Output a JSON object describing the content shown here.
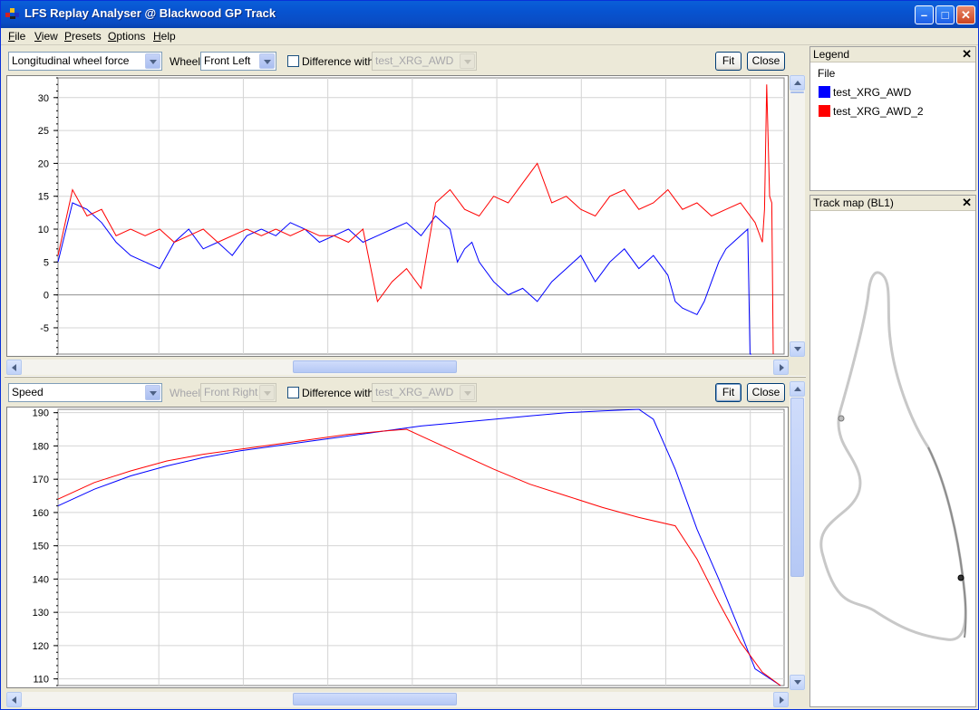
{
  "window": {
    "title": "LFS Replay Analyser @ Blackwood GP Track"
  },
  "menu": [
    {
      "label": "File",
      "key": "F",
      "rest": "ile"
    },
    {
      "label": "View",
      "key": "V",
      "rest": "iew"
    },
    {
      "label": "Presets",
      "key": "P",
      "rest": "resets"
    },
    {
      "label": "Options",
      "key": "O",
      "rest": "ptions"
    },
    {
      "label": "Help",
      "key": "H",
      "rest": "elp"
    }
  ],
  "top_panel": {
    "channel": "Longitudinal wheel force",
    "wheel_label": "Wheel",
    "wheel_value": "Front Left",
    "difference_label": "Difference with",
    "difference_value": "test_XRG_AWD",
    "fit_label": "Fit",
    "close_label": "Close"
  },
  "bottom_panel": {
    "channel": "Speed",
    "wheel_label": "Wheel",
    "wheel_value": "Front Right",
    "difference_label": "Difference with",
    "difference_value": "test_XRG_AWD",
    "fit_label": "Fit",
    "close_label": "Close"
  },
  "legend": {
    "title": "Legend",
    "column": "File",
    "items": [
      {
        "name": "test_XRG_AWD",
        "color": "#0000ff"
      },
      {
        "name": "test_XRG_AWD_2",
        "color": "#ff0000"
      }
    ]
  },
  "track_map": {
    "title": "Track map (BL1)"
  },
  "chart_data": [
    {
      "type": "line",
      "ylim": [
        -9,
        33
      ],
      "yticks": [
        -5,
        0,
        5,
        10,
        15,
        20,
        25,
        30
      ],
      "xlim": [
        0,
        100
      ],
      "series": [
        {
          "name": "test_XRG_AWD",
          "color": "#0000ff",
          "x": [
            0,
            2,
            4,
            6,
            8,
            10,
            12,
            14,
            16,
            18,
            20,
            22,
            24,
            26,
            28,
            30,
            32,
            34,
            36,
            38,
            40,
            42,
            44,
            46,
            48,
            50,
            52,
            54,
            55,
            56,
            57,
            58,
            60,
            62,
            64,
            66,
            68,
            70,
            72,
            74,
            76,
            78,
            80,
            82,
            84,
            85,
            86,
            88,
            89,
            90,
            91,
            92,
            93,
            94,
            95,
            95.3,
            95.4,
            95.5
          ],
          "y": [
            5,
            14,
            13,
            11,
            8,
            6,
            5,
            4,
            8,
            10,
            7,
            8,
            6,
            9,
            10,
            9,
            11,
            10,
            8,
            9,
            10,
            8,
            9,
            10,
            11,
            9,
            12,
            10,
            5,
            7,
            8,
            5,
            2,
            0,
            1,
            -1,
            2,
            4,
            6,
            2,
            5,
            7,
            4,
            6,
            3,
            -1,
            -2,
            -3,
            -1,
            2,
            5,
            7,
            8,
            9,
            10,
            -9,
            -9,
            -9
          ]
        },
        {
          "name": "test_XRG_AWD_2",
          "color": "#ff0000",
          "x": [
            0,
            2,
            4,
            6,
            8,
            10,
            12,
            14,
            16,
            18,
            20,
            22,
            24,
            26,
            28,
            30,
            32,
            34,
            36,
            38,
            40,
            42,
            44,
            46,
            48,
            50,
            52,
            54,
            56,
            58,
            60,
            62,
            64,
            66,
            68,
            70,
            72,
            74,
            76,
            78,
            80,
            82,
            84,
            86,
            88,
            90,
            92,
            94,
            96,
            97,
            97.3,
            97.6,
            98,
            98.3,
            98.5
          ],
          "y": [
            6,
            16,
            12,
            13,
            9,
            10,
            9,
            10,
            8,
            9,
            10,
            8,
            9,
            10,
            9,
            10,
            9,
            10,
            9,
            9,
            8,
            10,
            -1,
            2,
            4,
            1,
            14,
            16,
            13,
            12,
            15,
            14,
            17,
            20,
            14,
            15,
            13,
            12,
            15,
            16,
            13,
            14,
            16,
            13,
            14,
            12,
            13,
            14,
            11,
            8,
            13,
            32,
            15,
            14,
            -9
          ]
        }
      ]
    },
    {
      "type": "line",
      "ylim": [
        108,
        191
      ],
      "yticks": [
        110,
        120,
        130,
        140,
        150,
        160,
        170,
        180,
        190
      ],
      "xlim": [
        0,
        100
      ],
      "series": [
        {
          "name": "test_XRG_AWD",
          "color": "#0000ff",
          "x": [
            0,
            5,
            10,
            15,
            20,
            25,
            30,
            35,
            40,
            45,
            50,
            55,
            60,
            65,
            70,
            75,
            80,
            82,
            85,
            88,
            91,
            94,
            96,
            99.5
          ],
          "y": [
            162,
            167,
            171,
            174,
            176.5,
            178.5,
            180,
            181.5,
            183,
            184.5,
            186,
            187,
            188,
            189,
            190,
            190.5,
            191,
            188,
            173,
            155,
            140,
            124,
            113,
            108
          ]
        },
        {
          "name": "test_XRG_AWD_2",
          "color": "#ff0000",
          "x": [
            0,
            5,
            10,
            15,
            20,
            25,
            30,
            35,
            40,
            45,
            48,
            50,
            55,
            60,
            65,
            70,
            75,
            80,
            85,
            88,
            91,
            94,
            97,
            99.5
          ],
          "y": [
            164,
            169,
            172.5,
            175.5,
            177.5,
            179,
            180.5,
            182,
            183.5,
            184.5,
            185,
            183,
            178,
            173,
            168.5,
            165,
            161.5,
            158.5,
            156,
            146,
            133,
            121,
            112,
            108
          ]
        }
      ]
    }
  ]
}
